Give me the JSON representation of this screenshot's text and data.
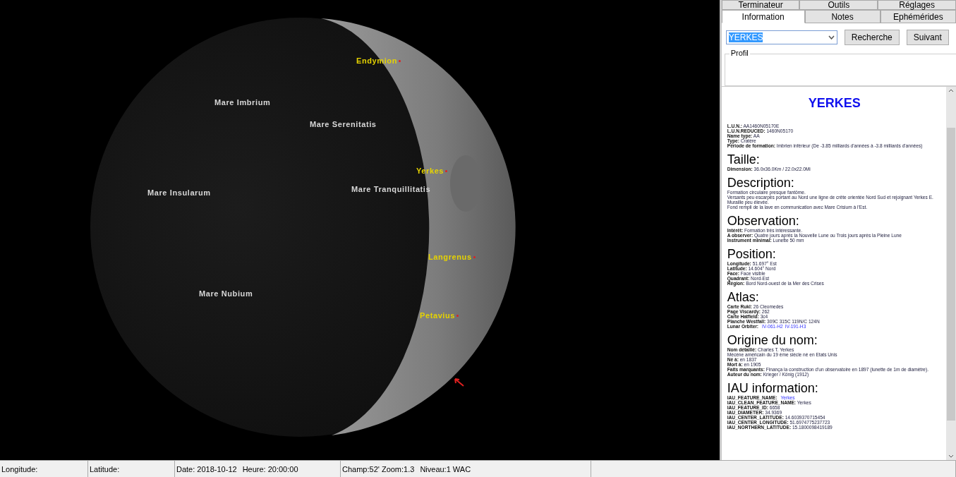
{
  "moon_view": {
    "labels": [
      {
        "text": "Endymion",
        "kind": "crater"
      },
      {
        "text": "Mare Imbrium",
        "kind": "mare"
      },
      {
        "text": "Mare Serenitatis",
        "kind": "mare"
      },
      {
        "text": "Yerkes",
        "kind": "crater"
      },
      {
        "text": "Mare Insularum",
        "kind": "mare"
      },
      {
        "text": "Mare Tranquillitatis",
        "kind": "mare"
      },
      {
        "text": "Langrenus",
        "kind": "crater"
      },
      {
        "text": "Mare Nubium",
        "kind": "mare"
      },
      {
        "text": "Petavius",
        "kind": "crater"
      }
    ]
  },
  "tabs": [
    [
      {
        "label": "Terminateur",
        "selected": false
      },
      {
        "label": "Outils",
        "selected": false
      },
      {
        "label": "Réglages",
        "selected": false
      }
    ],
    [
      {
        "label": "Information",
        "selected": true
      },
      {
        "label": "Notes",
        "selected": false
      },
      {
        "label": "Ephémérides",
        "selected": false
      }
    ]
  ],
  "search": {
    "value": "YERKES",
    "buttons": [
      "Recherche",
      "Suivant"
    ]
  },
  "profil": {
    "title": "Profil"
  },
  "info": {
    "title": "YERKES",
    "intro": [
      {
        "label": "L.U.N.:",
        "value": "AA1460N05170E"
      },
      {
        "label": "L.U.N.REDUCED:",
        "value": "1460N05170"
      },
      {
        "label": "Name type:",
        "value": "AA"
      },
      {
        "label": "Type:",
        "value": "Cratère"
      },
      {
        "label": "Période de formation:",
        "value": "Imbrien inférieur (De -3.85 milliards d'années à -3.8 milliards d'années)"
      }
    ],
    "sections": [
      {
        "heading": "Taille:",
        "lines": [
          {
            "label": "Dimension:",
            "value": "36.0x36.0Km / 22.0x22.0Mi"
          }
        ]
      },
      {
        "heading": "Description:",
        "lines": [
          {
            "value": "Formation circulaire presque fantôme."
          },
          {
            "value": "Versants peu escarpés portant au Nord une ligne de crête orientée Nord Sud et rejoignant Yerkes E."
          },
          {
            "value": "Muraille peu élevée."
          },
          {
            "value": "Fond rempli de la lave en communication avec Mare Crisium à l'Est."
          }
        ]
      },
      {
        "heading": "Observation:",
        "lines": [
          {
            "label": "Intérêt:",
            "value": "Formation très intéressante."
          },
          {
            "label": "A observer:",
            "value": "Quatre jours après la Nouvelle Lune ou Trois jours après la Pleine Lune"
          },
          {
            "label": "Instrument minimal:",
            "value": "Lunette 50 mm"
          }
        ]
      },
      {
        "heading": "Position:",
        "lines": [
          {
            "label": "Longitude:",
            "value": "51.697° Est"
          },
          {
            "label": "Latitude:",
            "value": "14.604° Nord"
          },
          {
            "label": "Face:",
            "value": "Face visible"
          },
          {
            "label": "Quadrant:",
            "value": "Nord-Est"
          },
          {
            "label": "Région:",
            "value": "Bord Nord-ouest de la Mer des Crises"
          }
        ]
      },
      {
        "heading": "Atlas:",
        "lines": [
          {
            "label": "Carte Rukl:",
            "value": "26 Cleomedes"
          },
          {
            "label": "Page Viscardy:",
            "value": "262"
          },
          {
            "label": "Carte Hatfield:",
            "value": "3c4"
          },
          {
            "label": "Planche Westfall:",
            "value": "309C 315C 119N/C 124N"
          },
          {
            "label": "Lunar Orbiter:",
            "links": [
              "IV-061-H2",
              "IV-191-H3"
            ]
          }
        ]
      },
      {
        "heading": "Origine du nom:",
        "lines": [
          {
            "label": "Nom détaillé:",
            "value": "Charles T. Yerkes"
          },
          {
            "value": "Mécène américain du 19 ème siècle né en Etats Unis"
          },
          {
            "label": "Né à:",
            "value": "en 1837"
          },
          {
            "label": "Mort à:",
            "value": "en 1905"
          },
          {
            "label": "Faits marquants:",
            "value": "Finança la construction d'un observatoire en 1897 (lunette de 1m de diamètre)."
          },
          {
            "label": "Auteur du nom:",
            "value": "Krieger / König (1912)"
          }
        ]
      },
      {
        "heading": "IAU information:",
        "lines": [
          {
            "label": "IAU_FEATURE_NAME:",
            "links": [
              "Yerkes"
            ]
          },
          {
            "label": "IAU_CLEAN_FEATURE_NAME:",
            "value": "Yerkes"
          },
          {
            "label": "IAU_FEATURE_ID:",
            "value": "6658"
          },
          {
            "label": "IAU_DIAMETER:",
            "value": "34.9369"
          },
          {
            "label": "IAU_CENTER_LATITUDE:",
            "value": "14.6039370715454"
          },
          {
            "label": "IAU_CENTER_LONGITUDE:",
            "value": "51.6974775237723"
          },
          {
            "label": "IAU_NORTHERN_LATITUDE:",
            "value": "15.1800098419189"
          }
        ]
      }
    ]
  },
  "status_bar": [
    [
      "Longitude:"
    ],
    [
      "Latitude:"
    ],
    [
      "Date: 2018-10-12",
      "Heure: 20:00:00"
    ],
    [
      "Champ:52' Zoom:1.3",
      "Niveau:1 WAC"
    ]
  ]
}
